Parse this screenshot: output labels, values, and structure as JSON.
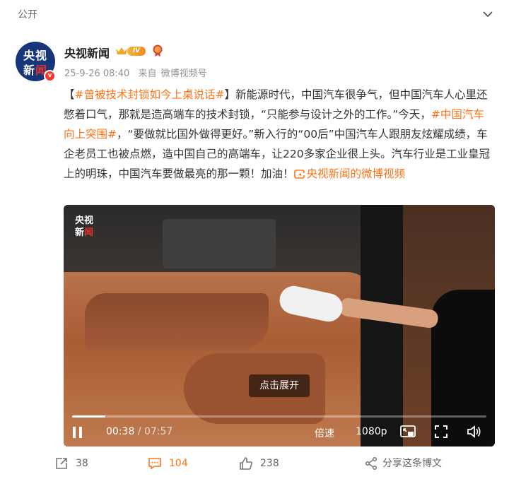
{
  "header": {
    "visibility_label": "公开"
  },
  "author": {
    "avatar_line1": "央视",
    "avatar_line2_a": "新",
    "avatar_line2_b": "闻",
    "verified_badge": "v",
    "name": "央视新闻",
    "level_badge": "IV"
  },
  "post_meta": {
    "time": "25-9-26 08:40",
    "source_prefix": "来自",
    "source": "微博视频号"
  },
  "content": {
    "bracket_open": "【",
    "topic1": "#曾被技术封锁如今上桌说话#",
    "bracket_close": "】",
    "text1": "新能源时代，中国汽车很争气，但中国汽车人心里还憋着口气，那就是造高端车的技术封锁，“只能参与设计之外的工作。”今天，",
    "topic2": "#中国汽车向上突围#",
    "text2": "，“要做就比国外做得更好。”新入行的“00后”中国汽车人跟朋友炫耀成绩，车企老员工也被点燃，造中国自己的高端车，让220多家企业很上头。汽车行业是工业皇冠上的明珠，中国汽车要做最亮的那一颗！加油！",
    "video_link": "央视新闻的微博视频"
  },
  "video": {
    "watermark_line1": "央视",
    "watermark_line2_a": "新",
    "watermark_line2_b": "闻",
    "expand_label": "点击展开",
    "current_time": "00:38",
    "separator": " / ",
    "duration": "07:57",
    "progress_fraction": 0.0797,
    "speed_label": "倍速",
    "resolution_label": "1080p"
  },
  "actions": {
    "repost_count": "38",
    "comment_count": "104",
    "like_count": "238",
    "share_label": "分享这条博文"
  },
  "colors": {
    "accent": "#ff7316",
    "meta_gray": "#939393"
  },
  "icons": [
    "chevron-down-icon",
    "crown-icon",
    "medal-icon",
    "link-icon",
    "play-pause-icon",
    "pip-icon",
    "fullscreen-icon",
    "volume-icon",
    "repost-icon",
    "comment-icon",
    "like-icon",
    "share-icon"
  ]
}
